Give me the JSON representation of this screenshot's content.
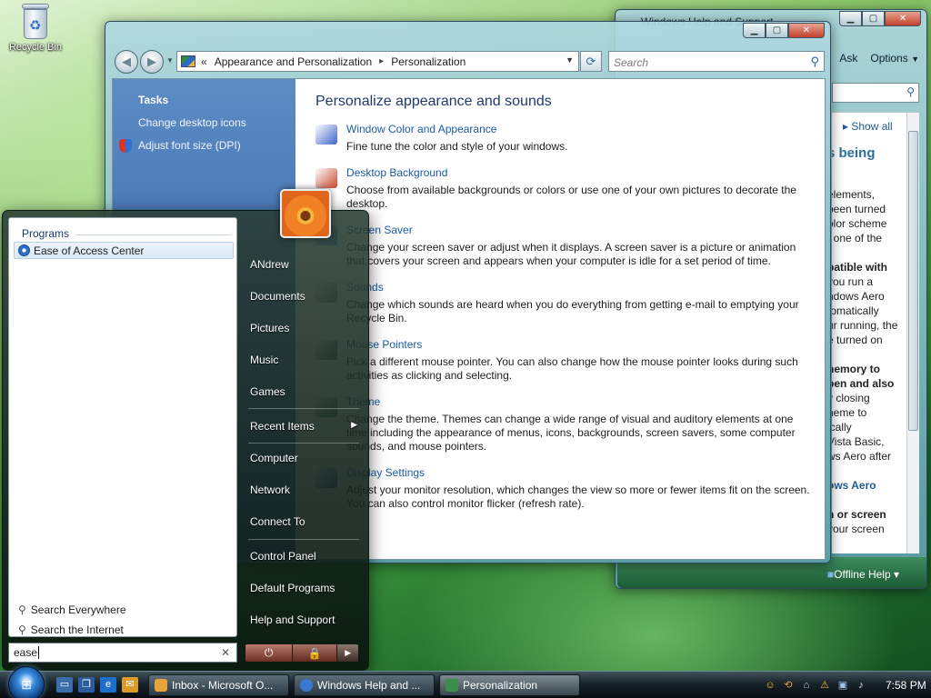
{
  "desktop": {
    "recycle_bin_label": "Recycle Bin"
  },
  "help_window": {
    "title": "Windows Help and Support",
    "toolbar": {
      "ask_label": "Ask",
      "options_label": "Options",
      "options_arrow": "▼"
    },
    "show_all_label": "Show all",
    "heading": "ts being",
    "lines": [
      {
        "text": "elements,",
        "style": ""
      },
      {
        "text": "been turned",
        "style": ""
      },
      {
        "text": "olor scheme",
        "style": ""
      },
      {
        "text": ", one of the",
        "style": ""
      },
      {
        "text": "",
        "style": ""
      },
      {
        "text": "patible with",
        "style": "b"
      },
      {
        "text": "you run a",
        "style": ""
      },
      {
        "text": "ndows Aero",
        "style": ""
      },
      {
        "text": "tomatically",
        "style": ""
      },
      {
        "text": "ur running, the",
        "style": ""
      },
      {
        "text": "e turned on",
        "style": ""
      },
      {
        "text": "",
        "style": ""
      },
      {
        "text": "nemory to",
        "style": "b"
      },
      {
        "text": "pen and also",
        "style": "b"
      },
      {
        "text": "y closing",
        "style": ""
      },
      {
        "text": "heme to",
        "style": ""
      },
      {
        "text": "ically",
        "style": ""
      },
      {
        "text": "Vista Basic,",
        "style": ""
      },
      {
        "text": "ws Aero after",
        "style": ""
      },
      {
        "text": "",
        "style": ""
      },
      {
        "text": "ows Aero",
        "style": "blue"
      },
      {
        "text": "",
        "style": ""
      },
      {
        "text": "n or screen",
        "style": "b"
      },
      {
        "text": "your screen",
        "style": ""
      }
    ],
    "offline_help_label": "Offline Help ▾"
  },
  "personalization_window": {
    "breadcrumb": {
      "prefix": "«",
      "part1": "Appearance and Personalization",
      "separator": "▸",
      "part2": "Personalization"
    },
    "search_placeholder": "Search",
    "tasks": {
      "header": "Tasks",
      "links": [
        "Change desktop icons",
        "Adjust font size (DPI)"
      ]
    },
    "heading": "Personalize appearance and sounds",
    "items": [
      {
        "link": "Window Color and Appearance",
        "desc": "Fine tune the color and style of your windows.",
        "icon_color": "#3b63c9"
      },
      {
        "link": "Desktop Background",
        "desc": "Choose from available backgrounds or colors or use one of your own pictures to decorate the desktop.",
        "icon_color": "#c9472f"
      },
      {
        "link": "Screen Saver",
        "desc": "Change your screen saver or adjust when it displays. A screen saver is a picture or animation that covers your screen and appears when your computer is idle for a set period of time.",
        "icon_color": "#2f7fc9"
      },
      {
        "link": "Sounds",
        "desc": "Change which sounds are heard when you do everything from getting e-mail to emptying your Recycle Bin.",
        "icon_color": "#8a8a8a"
      },
      {
        "link": "Mouse Pointers",
        "desc": "Pick a different mouse pointer. You can also change how the mouse pointer looks during such activities as clicking and selecting.",
        "icon_color": "#555555"
      },
      {
        "link": "Theme",
        "desc": "Change the theme. Themes can change a wide range of visual and auditory elements at one time including the appearance of menus, icons, backgrounds, screen savers, some computer sounds, and mouse pointers.",
        "icon_color": "#3a8f4a"
      },
      {
        "link": "Display Settings",
        "desc": "Adjust your monitor resolution, which changes the view so more or fewer items fit on the screen. You can also control monitor flicker (refresh rate).",
        "icon_color": "#2b5fb8"
      }
    ]
  },
  "start_menu": {
    "programs_label": "Programs",
    "result_label": "Ease of Access Center",
    "search_everywhere_label": "Search Everywhere",
    "search_internet_label": "Search the Internet",
    "search_value": "ease",
    "clear_label": "✕",
    "right_items": {
      "user": "ANdrew",
      "documents": "Documents",
      "pictures": "Pictures",
      "music": "Music",
      "games": "Games",
      "recent": "Recent Items",
      "computer": "Computer",
      "network": "Network",
      "connect": "Connect To",
      "control_panel": "Control Panel",
      "default_programs": "Default Programs",
      "help": "Help and Support"
    },
    "submenu_arrow": "▶",
    "power_icon": "⏻",
    "lock_icon": "🔒",
    "arrow_icon": "▶"
  },
  "taskbar": {
    "buttons": [
      {
        "label": "Inbox - Microsoft O...",
        "icon_color": "#e8a43a"
      },
      {
        "label": "Windows Help and ...",
        "icon_color": "#3a78d0"
      },
      {
        "label": "Personalization",
        "icon_color": "#3b8f4a"
      }
    ],
    "clock": "7:58 PM"
  }
}
